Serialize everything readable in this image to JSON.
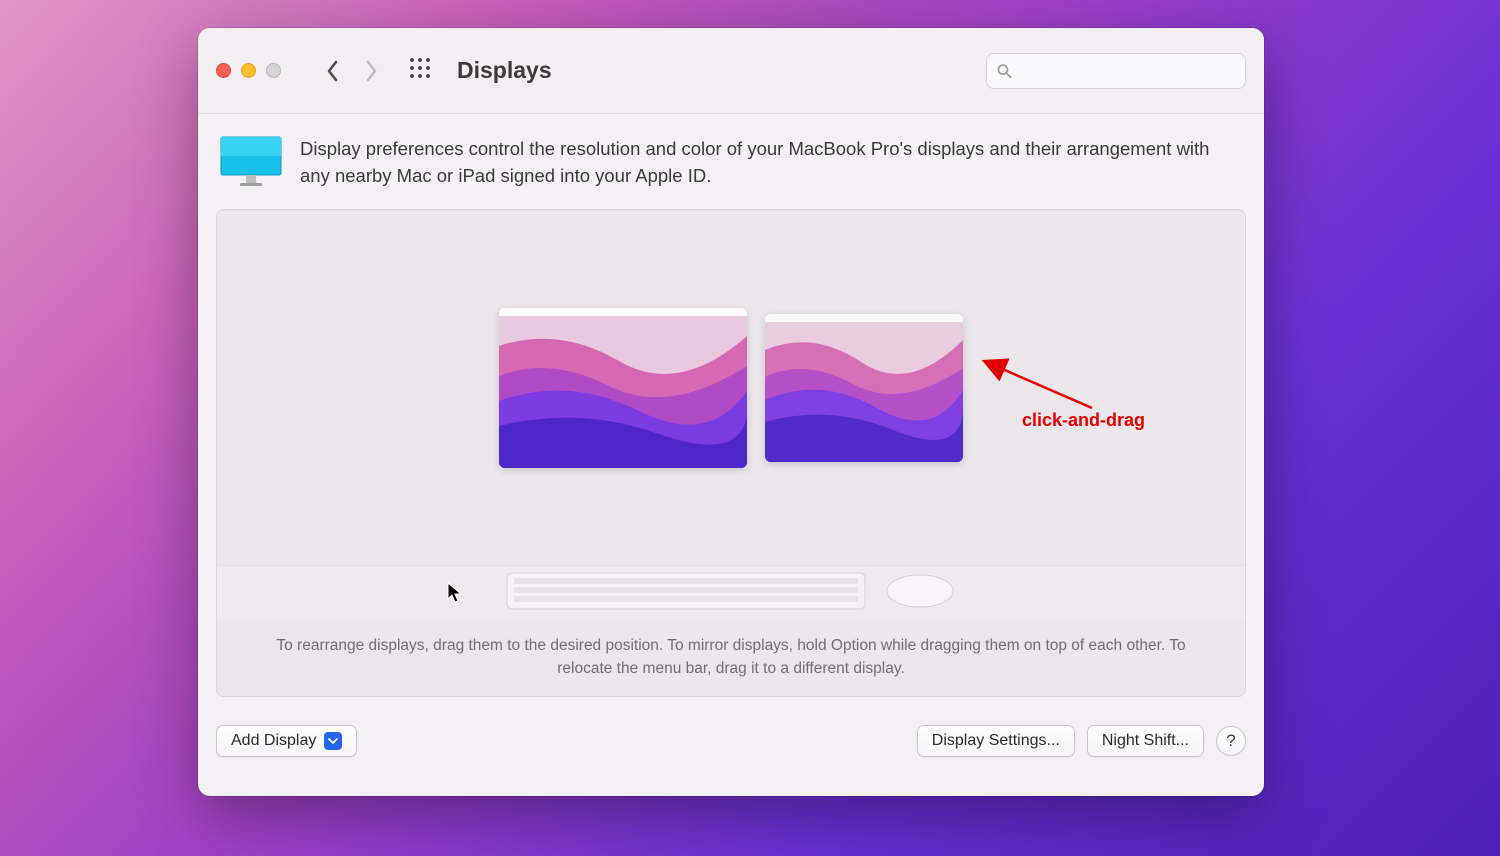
{
  "window": {
    "title": "Displays"
  },
  "search": {
    "placeholder": ""
  },
  "intro": {
    "text": "Display preferences control the resolution and color of your MacBook Pro's displays and their arrangement with any nearby Mac or iPad signed into your Apple ID."
  },
  "annotation": {
    "label": "click-and-drag"
  },
  "instructions": {
    "text": "To rearrange displays, drag them to the desired position. To mirror displays, hold Option while dragging them on top of each other. To relocate the menu bar, drag it to a different display."
  },
  "footer": {
    "add_display": "Add Display",
    "display_settings": "Display Settings...",
    "night_shift": "Night Shift...",
    "help": "?"
  }
}
